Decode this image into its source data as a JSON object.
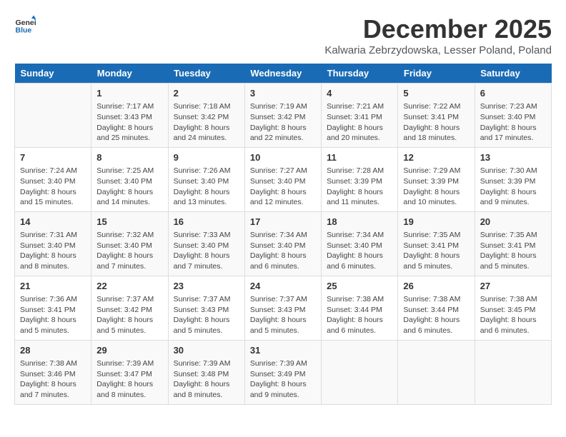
{
  "header": {
    "logo_line1": "General",
    "logo_line2": "Blue",
    "month_title": "December 2025",
    "subtitle": "Kalwaria Zebrzydowska, Lesser Poland, Poland"
  },
  "days_of_week": [
    "Sunday",
    "Monday",
    "Tuesday",
    "Wednesday",
    "Thursday",
    "Friday",
    "Saturday"
  ],
  "weeks": [
    [
      {
        "day": "",
        "content": ""
      },
      {
        "day": "1",
        "content": "Sunrise: 7:17 AM\nSunset: 3:43 PM\nDaylight: 8 hours\nand 25 minutes."
      },
      {
        "day": "2",
        "content": "Sunrise: 7:18 AM\nSunset: 3:42 PM\nDaylight: 8 hours\nand 24 minutes."
      },
      {
        "day": "3",
        "content": "Sunrise: 7:19 AM\nSunset: 3:42 PM\nDaylight: 8 hours\nand 22 minutes."
      },
      {
        "day": "4",
        "content": "Sunrise: 7:21 AM\nSunset: 3:41 PM\nDaylight: 8 hours\nand 20 minutes."
      },
      {
        "day": "5",
        "content": "Sunrise: 7:22 AM\nSunset: 3:41 PM\nDaylight: 8 hours\nand 18 minutes."
      },
      {
        "day": "6",
        "content": "Sunrise: 7:23 AM\nSunset: 3:40 PM\nDaylight: 8 hours\nand 17 minutes."
      }
    ],
    [
      {
        "day": "7",
        "content": "Sunrise: 7:24 AM\nSunset: 3:40 PM\nDaylight: 8 hours\nand 15 minutes."
      },
      {
        "day": "8",
        "content": "Sunrise: 7:25 AM\nSunset: 3:40 PM\nDaylight: 8 hours\nand 14 minutes."
      },
      {
        "day": "9",
        "content": "Sunrise: 7:26 AM\nSunset: 3:40 PM\nDaylight: 8 hours\nand 13 minutes."
      },
      {
        "day": "10",
        "content": "Sunrise: 7:27 AM\nSunset: 3:40 PM\nDaylight: 8 hours\nand 12 minutes."
      },
      {
        "day": "11",
        "content": "Sunrise: 7:28 AM\nSunset: 3:39 PM\nDaylight: 8 hours\nand 11 minutes."
      },
      {
        "day": "12",
        "content": "Sunrise: 7:29 AM\nSunset: 3:39 PM\nDaylight: 8 hours\nand 10 minutes."
      },
      {
        "day": "13",
        "content": "Sunrise: 7:30 AM\nSunset: 3:39 PM\nDaylight: 8 hours\nand 9 minutes."
      }
    ],
    [
      {
        "day": "14",
        "content": "Sunrise: 7:31 AM\nSunset: 3:40 PM\nDaylight: 8 hours\nand 8 minutes."
      },
      {
        "day": "15",
        "content": "Sunrise: 7:32 AM\nSunset: 3:40 PM\nDaylight: 8 hours\nand 7 minutes."
      },
      {
        "day": "16",
        "content": "Sunrise: 7:33 AM\nSunset: 3:40 PM\nDaylight: 8 hours\nand 7 minutes."
      },
      {
        "day": "17",
        "content": "Sunrise: 7:34 AM\nSunset: 3:40 PM\nDaylight: 8 hours\nand 6 minutes."
      },
      {
        "day": "18",
        "content": "Sunrise: 7:34 AM\nSunset: 3:40 PM\nDaylight: 8 hours\nand 6 minutes."
      },
      {
        "day": "19",
        "content": "Sunrise: 7:35 AM\nSunset: 3:41 PM\nDaylight: 8 hours\nand 5 minutes."
      },
      {
        "day": "20",
        "content": "Sunrise: 7:35 AM\nSunset: 3:41 PM\nDaylight: 8 hours\nand 5 minutes."
      }
    ],
    [
      {
        "day": "21",
        "content": "Sunrise: 7:36 AM\nSunset: 3:41 PM\nDaylight: 8 hours\nand 5 minutes."
      },
      {
        "day": "22",
        "content": "Sunrise: 7:37 AM\nSunset: 3:42 PM\nDaylight: 8 hours\nand 5 minutes."
      },
      {
        "day": "23",
        "content": "Sunrise: 7:37 AM\nSunset: 3:43 PM\nDaylight: 8 hours\nand 5 minutes."
      },
      {
        "day": "24",
        "content": "Sunrise: 7:37 AM\nSunset: 3:43 PM\nDaylight: 8 hours\nand 5 minutes."
      },
      {
        "day": "25",
        "content": "Sunrise: 7:38 AM\nSunset: 3:44 PM\nDaylight: 8 hours\nand 6 minutes."
      },
      {
        "day": "26",
        "content": "Sunrise: 7:38 AM\nSunset: 3:44 PM\nDaylight: 8 hours\nand 6 minutes."
      },
      {
        "day": "27",
        "content": "Sunrise: 7:38 AM\nSunset: 3:45 PM\nDaylight: 8 hours\nand 6 minutes."
      }
    ],
    [
      {
        "day": "28",
        "content": "Sunrise: 7:38 AM\nSunset: 3:46 PM\nDaylight: 8 hours\nand 7 minutes."
      },
      {
        "day": "29",
        "content": "Sunrise: 7:39 AM\nSunset: 3:47 PM\nDaylight: 8 hours\nand 8 minutes."
      },
      {
        "day": "30",
        "content": "Sunrise: 7:39 AM\nSunset: 3:48 PM\nDaylight: 8 hours\nand 8 minutes."
      },
      {
        "day": "31",
        "content": "Sunrise: 7:39 AM\nSunset: 3:49 PM\nDaylight: 8 hours\nand 9 minutes."
      },
      {
        "day": "",
        "content": ""
      },
      {
        "day": "",
        "content": ""
      },
      {
        "day": "",
        "content": ""
      }
    ]
  ]
}
